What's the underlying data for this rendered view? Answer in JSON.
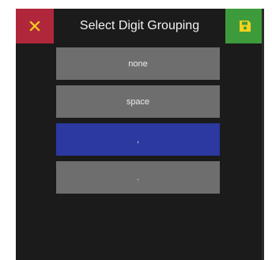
{
  "dialog": {
    "title": "Select Digit Grouping",
    "close_icon": "close-icon",
    "save_icon": "save-icon",
    "colors": {
      "background": "#1b1b1b",
      "close": "#b0273b",
      "save": "#3e9b3c",
      "option": "#6e6e6e",
      "selected": "#2b39a0"
    }
  },
  "options": [
    {
      "label": "none",
      "selected": false
    },
    {
      "label": "space",
      "selected": false
    },
    {
      "label": ",",
      "selected": true
    },
    {
      "label": ".",
      "selected": false
    }
  ]
}
